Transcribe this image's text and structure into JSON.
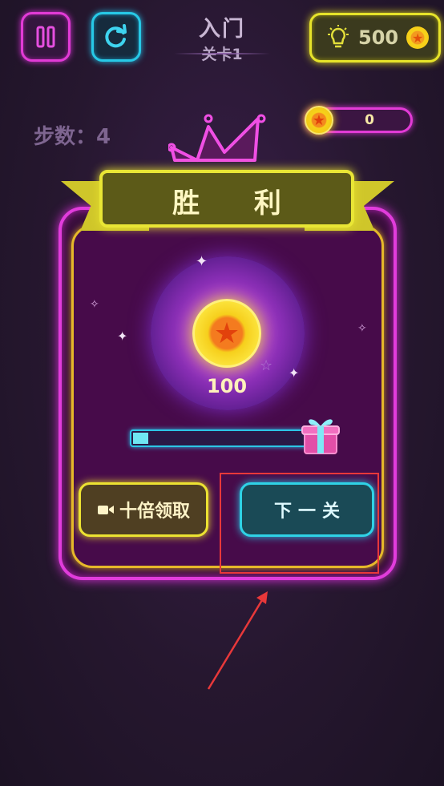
{
  "header": {
    "level_name": "入门",
    "level_number": "关卡1",
    "hints": "500"
  },
  "steps": "步数：4",
  "coin_bar": {
    "value": "0"
  },
  "dialog": {
    "title": "胜 利",
    "reward_amount": "100",
    "progress": 0.08,
    "video_button": "十倍领取",
    "next_button": "下一关"
  },
  "colors": {
    "magenta_neon": "#e13cdc",
    "cyan_neon": "#2fd2e6",
    "yellow_neon": "#e9e635",
    "annotation_red": "#e8383a"
  },
  "icons": {
    "pause": "pause-icon",
    "restart": "restart-icon",
    "hint": "lightbulb-icon",
    "coin": "star-coin-icon",
    "video": "video-camera-icon",
    "gift": "gift-box-icon"
  }
}
